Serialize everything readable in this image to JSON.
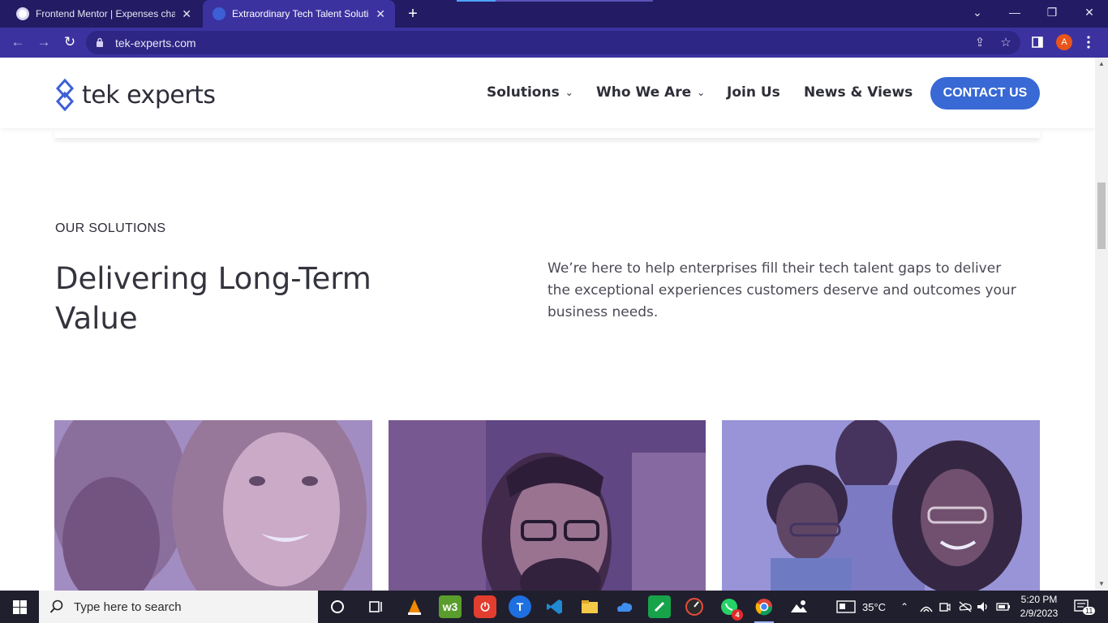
{
  "browser": {
    "tabs": [
      {
        "title": "Frontend Mentor | Expenses char",
        "active": false
      },
      {
        "title": "Extraordinary Tech Talent Solution",
        "active": true
      }
    ],
    "new_tab_label": "+",
    "url": "tek-experts.com",
    "profile_initial": "A",
    "accent": "#3b32a0"
  },
  "site": {
    "logo_text": "tek experts",
    "nav": [
      {
        "label": "Solutions",
        "has_dropdown": true
      },
      {
        "label": "Who We Are",
        "has_dropdown": true
      },
      {
        "label": "Join Us",
        "has_dropdown": false
      },
      {
        "label": "News & Views",
        "has_dropdown": false
      }
    ],
    "contact_label": "CONTACT US",
    "brand_color": "#3869d4"
  },
  "section": {
    "eyebrow": "OUR SOLUTIONS",
    "heading": "Delivering Long-Term Value",
    "intro": "We’re here to help enterprises fill their tech talent gaps to deliver the exceptional experiences customers deserve and outcomes your business needs."
  },
  "taskbar": {
    "search_placeholder": "Type here to search",
    "weather": "35°C",
    "time": "5:20 PM",
    "date": "2/9/2023",
    "whatsapp_badge": "4",
    "notifications_badge": "11"
  }
}
